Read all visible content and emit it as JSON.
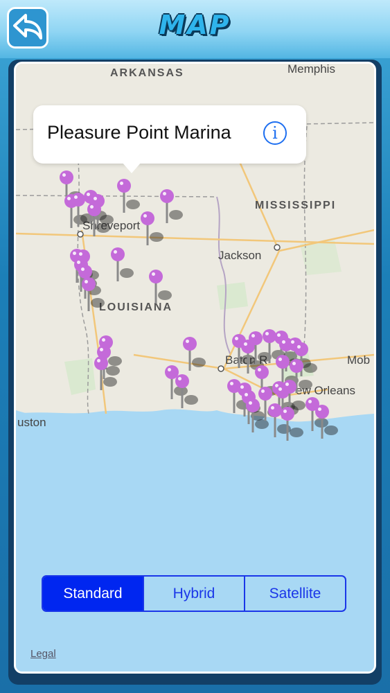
{
  "header": {
    "title": "MAP",
    "back_icon": "back-arrow-icon"
  },
  "map": {
    "labels": {
      "arkansas": "ARKANSAS",
      "memphis": "Memphis",
      "mississippi": "MISSISSIPPI",
      "shreveport": "Shreveport",
      "jackson": "Jackson",
      "louisiana": "LOUISIANA",
      "baton_rouge": "Baton R",
      "new_orleans": "ew Orleans",
      "mobile": "Mob",
      "houston": "uston"
    },
    "callout": {
      "title": "Pleasure Point Marina",
      "info_icon": "info-icon"
    },
    "pin_color": "#c46ad9"
  },
  "map_type": {
    "options": [
      "Standard",
      "Hybrid",
      "Satellite"
    ],
    "selected": "Standard"
  },
  "legal": "Legal"
}
